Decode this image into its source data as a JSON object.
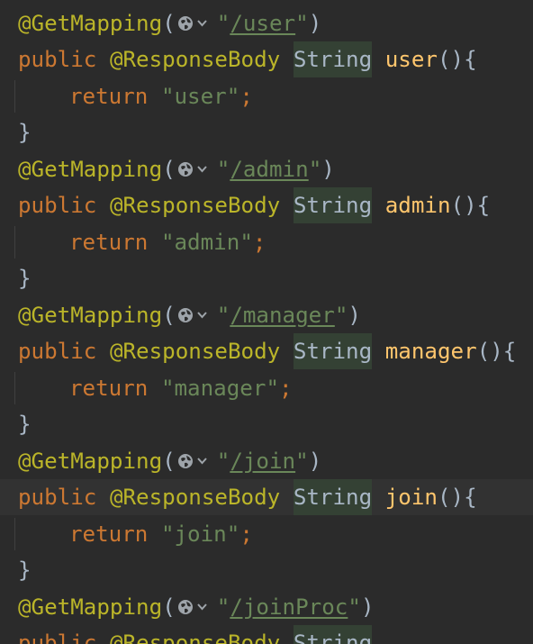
{
  "editor": {
    "blocks": [
      {
        "path": "/user",
        "method_name": "user",
        "return_value": "user"
      },
      {
        "path": "/admin",
        "method_name": "admin",
        "return_value": "admin"
      },
      {
        "path": "/manager",
        "method_name": "manager",
        "return_value": "manager"
      },
      {
        "path": "/join",
        "method_name": "join",
        "return_value": "join"
      },
      {
        "path": "/joinProc"
      }
    ],
    "tokens": {
      "annotation": "@GetMapping",
      "open_paren": "(",
      "close_paren": ")",
      "quote": "\"",
      "public_kw": "public",
      "response_body": "@ResponseBody",
      "string_type": "String",
      "method_suffix": "(){",
      "return_kw": "return",
      "semicolon": ";",
      "close_brace": "}"
    },
    "icons": {
      "endpoint_icon": "globe-icon",
      "endpoint_dropdown": "chevron-down-icon"
    },
    "colors": {
      "background": "#2b2b2b",
      "keyword": "#cc7832",
      "annotation": "#bbb529",
      "string": "#6a8759",
      "method": "#ffc66d",
      "text": "#a9b7c6",
      "type_highlight": "#344134",
      "current_line": "#323232"
    },
    "current_line_block": 3
  }
}
